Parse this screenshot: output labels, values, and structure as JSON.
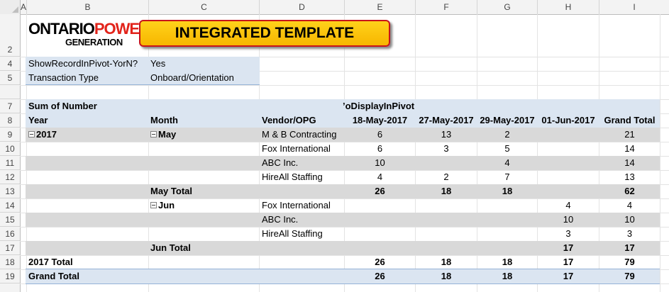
{
  "columns": [
    "A",
    "B",
    "C",
    "D",
    "E",
    "F",
    "G",
    "H",
    "I"
  ],
  "rows": [
    "2",
    "4",
    "5",
    "7",
    "8",
    "9",
    "10",
    "11",
    "12",
    "13",
    "14",
    "15",
    "16",
    "17",
    "18",
    "19"
  ],
  "logo": {
    "part1": "ONTARIO",
    "part2": "POWER",
    "part3": "GENERATION"
  },
  "title_button": "INTEGRATED TEMPLATE",
  "filters": [
    {
      "label": "ShowRecordInPivot-YorN?",
      "value": "Yes"
    },
    {
      "label": "Transaction Type",
      "value": "Onboard/Orientation"
    }
  ],
  "pivot": {
    "values_label": "Sum of Number",
    "column_field": "’oDisplayInPivot",
    "headers": {
      "year": "Year",
      "month": "Month",
      "vendor": "Vendor/OPG",
      "dates": [
        "18-May-2017",
        "27-May-2017",
        "29-May-2017",
        "01-Jun-2017"
      ],
      "grand_total": "Grand Total"
    },
    "rows": [
      {
        "year": "2017",
        "month": "May",
        "vendor": "M & B Contracting",
        "v": [
          "6",
          "13",
          "2",
          ""
        ],
        "total": "21"
      },
      {
        "year": "",
        "month": "",
        "vendor": "Fox International",
        "v": [
          "6",
          "3",
          "5",
          ""
        ],
        "total": "14"
      },
      {
        "year": "",
        "month": "",
        "vendor": "ABC Inc.",
        "v": [
          "10",
          "",
          "4",
          ""
        ],
        "total": "14"
      },
      {
        "year": "",
        "month": "",
        "vendor": "HireAll Staffing",
        "v": [
          "4",
          "2",
          "7",
          ""
        ],
        "total": "13"
      },
      {
        "year": "",
        "month": "May Total",
        "vendor": "",
        "v": [
          "26",
          "18",
          "18",
          ""
        ],
        "total": "62"
      },
      {
        "year": "",
        "month": "Jun",
        "vendor": "Fox International",
        "v": [
          "",
          "",
          "",
          "4"
        ],
        "total": "4"
      },
      {
        "year": "",
        "month": "",
        "vendor": "ABC Inc.",
        "v": [
          "",
          "",
          "",
          "10"
        ],
        "total": "10"
      },
      {
        "year": "",
        "month": "",
        "vendor": "HireAll Staffing",
        "v": [
          "",
          "",
          "",
          "3"
        ],
        "total": "3"
      },
      {
        "year": "",
        "month": "Jun Total",
        "vendor": "",
        "v": [
          "",
          "",
          "",
          "17"
        ],
        "total": "17"
      },
      {
        "year": "2017 Total",
        "month": "",
        "vendor": "",
        "v": [
          "26",
          "18",
          "18",
          "17"
        ],
        "total": "79"
      },
      {
        "year": "Grand Total",
        "month": "",
        "vendor": "",
        "v": [
          "26",
          "18",
          "18",
          "17"
        ],
        "total": "79"
      }
    ]
  }
}
